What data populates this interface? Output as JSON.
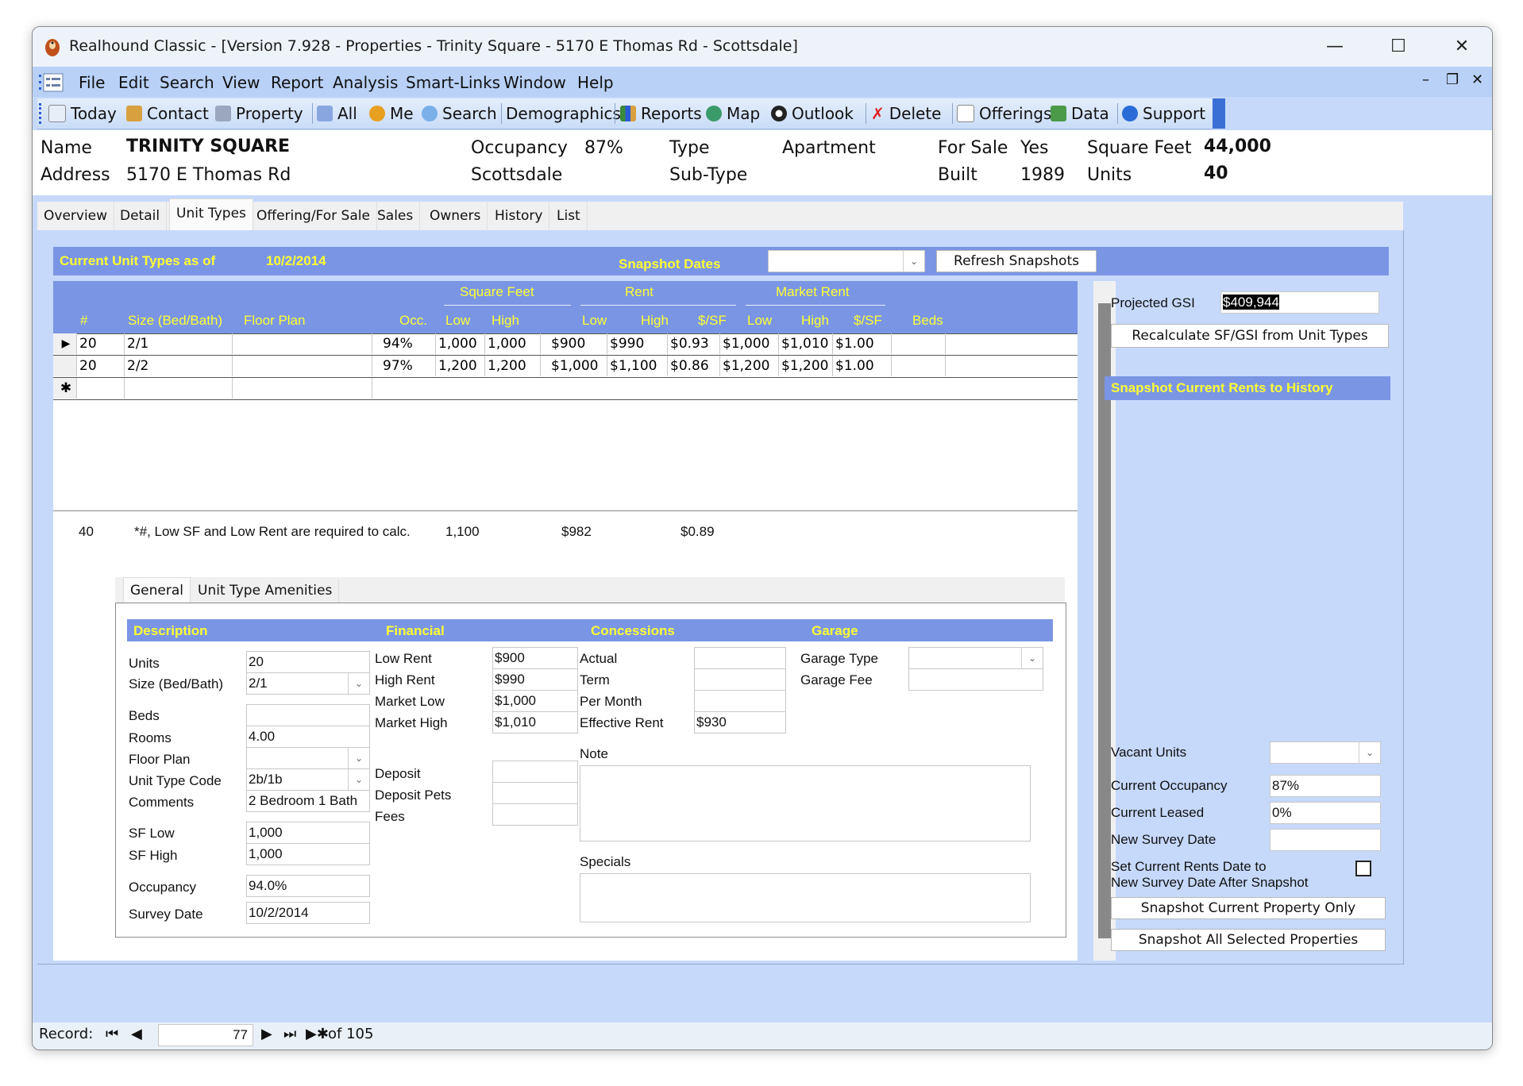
{
  "window": {
    "title": "Realhound Classic - [Version 7.928 - Properties - Trinity Square - 5170 E Thomas Rd - Scottsdale]",
    "controls": [
      "minimize",
      "maximize",
      "close"
    ]
  },
  "menu": {
    "items": [
      "File",
      "Edit",
      "Search",
      "View",
      "Report",
      "Analysis",
      "Smart-Links",
      "Window",
      "Help"
    ],
    "mdi_controls": [
      "minimize",
      "restore",
      "close"
    ]
  },
  "toolbar": {
    "items": [
      {
        "label": "Today",
        "icon": "calendar-icon"
      },
      {
        "label": "Contact",
        "icon": "contacts-icon"
      },
      {
        "label": "Property",
        "icon": "building-icon"
      },
      {
        "label": "All",
        "icon": "all-icon"
      },
      {
        "label": "Me",
        "icon": "person-icon"
      },
      {
        "label": "Search",
        "icon": "magnifier-icon"
      },
      {
        "label": "Demographics",
        "icon": ""
      },
      {
        "label": "Reports",
        "icon": "chart-icon"
      },
      {
        "label": "Map",
        "icon": "globe-icon"
      },
      {
        "label": "Outlook",
        "icon": "yin-yang-icon"
      },
      {
        "label": "Delete",
        "icon": "delete-icon"
      },
      {
        "label": "Offerings",
        "icon": "list-icon"
      },
      {
        "label": "Data",
        "icon": "data-icon"
      },
      {
        "label": "Support",
        "icon": "help-icon"
      }
    ]
  },
  "property": {
    "name_label": "Name",
    "name": "TRINITY SQUARE",
    "address_label": "Address",
    "address": "5170 E Thomas Rd",
    "occupancy_label": "Occupancy",
    "occupancy": "87%",
    "city": "Scottsdale",
    "type_label": "Type",
    "type": "Apartment",
    "subtype_label": "Sub-Type",
    "subtype": "",
    "forsale_label": "For Sale",
    "forsale": "Yes",
    "built_label": "Built",
    "built": "1989",
    "sqft_label": "Square Feet",
    "sqft": "44,000",
    "units_label": "Units",
    "units": "40"
  },
  "tabs": [
    "Overview",
    "Detail",
    "Unit Types",
    "Offering/For Sale",
    "Sales",
    "Owners",
    "History",
    "List"
  ],
  "active_tab": "Unit Types",
  "unit_types": {
    "header_label": "Current Unit Types as of",
    "header_date": "10/2/2014",
    "snapshot_label": "Snapshot Dates",
    "snapshot_value": "",
    "refresh_button": "Refresh Snapshots",
    "group_headers": {
      "sqft": "Square Feet",
      "rent": "Rent",
      "market": "Market Rent"
    },
    "columns": [
      "#",
      "Size (Bed/Bath)",
      "Floor Plan",
      "Occ.",
      "Low",
      "High",
      "Low",
      "High",
      "$/SF",
      "Low",
      "High",
      "$/SF",
      "Beds"
    ],
    "rows": [
      {
        "num": "20",
        "size": "2/1",
        "floor_plan": "",
        "occ": "94%",
        "sf_low": "1,000",
        "sf_high": "1,000",
        "rent_low": "$900",
        "rent_high": "$990",
        "rent_psf": "$0.93",
        "mkt_low": "$1,000",
        "mkt_high": "$1,010",
        "mkt_psf": "$1.00",
        "beds": ""
      },
      {
        "num": "20",
        "size": "2/2",
        "floor_plan": "",
        "occ": "97%",
        "sf_low": "1,200",
        "sf_high": "1,200",
        "rent_low": "$1,000",
        "rent_high": "$1,100",
        "rent_psf": "$0.86",
        "mkt_low": "$1,200",
        "mkt_high": "$1,200",
        "mkt_psf": "$1.00",
        "beds": ""
      }
    ],
    "totals": {
      "units": "40",
      "note": "*#, Low SF and Low Rent are required to calc.",
      "sf": "1,100",
      "rent": "$982",
      "psf": "$0.89"
    }
  },
  "right_panel": {
    "projected_gsi_label": "Projected GSI",
    "projected_gsi": "$409,944",
    "recalc_button": "Recalculate SF/GSI from Unit Types",
    "snapshot_header": "Snapshot Current Rents to History",
    "vacant_units_label": "Vacant Units",
    "vacant_units": "",
    "current_occupancy_label": "Current Occupancy",
    "current_occupancy": "87%",
    "current_leased_label": "Current Leased",
    "current_leased": "0%",
    "new_survey_label": "New Survey Date",
    "new_survey": "",
    "set_rents_label_1": "Set Current Rents Date to",
    "set_rents_label_2": "New Survey Date After Snapshot",
    "set_rents_checked": false,
    "snapshot_current_button": "Snapshot Current Property Only",
    "snapshot_all_button": "Snapshot All Selected Properties"
  },
  "detail_tabs": [
    "General",
    "Unit Type Amenities"
  ],
  "detail": {
    "sections": {
      "description": "Description",
      "financial": "Financial",
      "concessions": "Concessions",
      "garage": "Garage"
    },
    "description": {
      "units_label": "Units",
      "units": "20",
      "size_label": "Size (Bed/Bath)",
      "size": "2/1",
      "beds_label": "Beds",
      "beds": "",
      "rooms_label": "Rooms",
      "rooms": "4.00",
      "floor_plan_label": "Floor Plan",
      "floor_plan": "",
      "code_label": "Unit Type Code",
      "code": "2b/1b",
      "comments_label": "Comments",
      "comments": "2 Bedroom 1 Bath",
      "sf_low_label": "SF Low",
      "sf_low": "1,000",
      "sf_high_label": "SF High",
      "sf_high": "1,000",
      "occupancy_label": "Occupancy",
      "occupancy": "94.0%",
      "survey_label": "Survey Date",
      "survey": "10/2/2014"
    },
    "financial": {
      "low_rent_label": "Low Rent",
      "low_rent": "$900",
      "high_rent_label": "High Rent",
      "high_rent": "$990",
      "market_low_label": "Market Low",
      "market_low": "$1,000",
      "market_high_label": "Market High",
      "market_high": "$1,010",
      "deposit_label": "Deposit",
      "deposit": "",
      "deposit_pets_label": "Deposit Pets",
      "deposit_pets": "",
      "fees_label": "Fees",
      "fees": ""
    },
    "concessions": {
      "actual_label": "Actual",
      "actual": "",
      "term_label": "Term",
      "term": "",
      "per_month_label": "Per Month",
      "per_month": "",
      "effective_label": "Effective Rent",
      "effective": "$930",
      "note_label": "Note",
      "note": "",
      "specials_label": "Specials",
      "specials": ""
    },
    "garage": {
      "type_label": "Garage Type",
      "type": "",
      "fee_label": "Garage Fee",
      "fee": ""
    }
  },
  "record_nav": {
    "label": "Record:",
    "current": "77",
    "of_label": "of 105"
  },
  "colors": {
    "accent": "#7a95e4",
    "header_text": "#ffff33",
    "background": "#c6d9fb"
  }
}
